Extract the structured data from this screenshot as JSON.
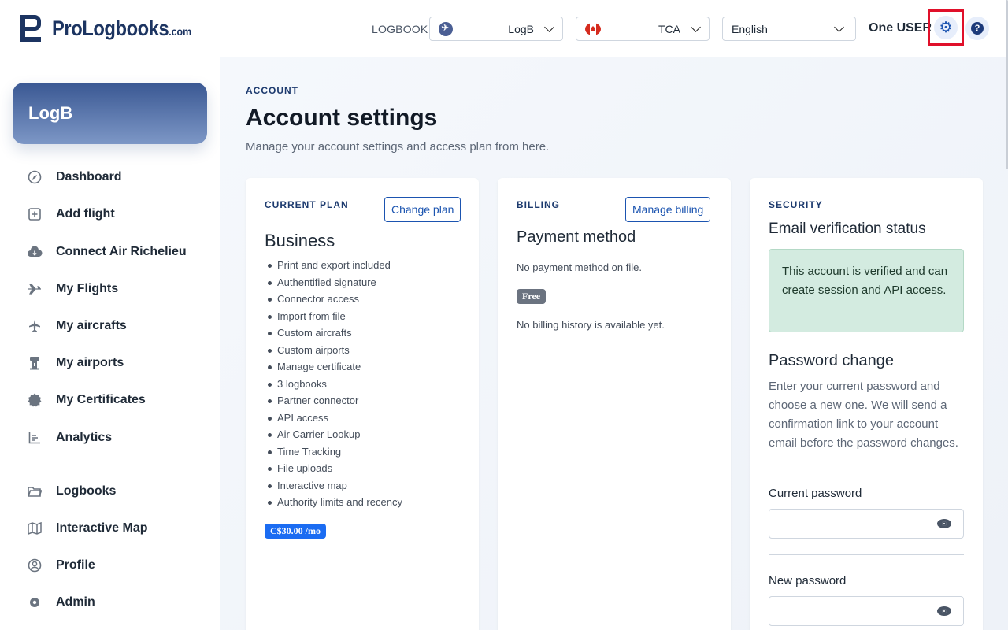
{
  "brand": {
    "name": "ProLogbooks",
    "suffix": ".com"
  },
  "header": {
    "logbook_label": "LOGBOOK",
    "logbook_select": "LogB",
    "country_select": "TCA",
    "language_select": "English",
    "user_name": "One USER",
    "help_glyph": "?"
  },
  "sidebar": {
    "logbook_card": "LogB",
    "items": [
      {
        "label": "Dashboard",
        "icon": "compass-icon"
      },
      {
        "label": "Add flight",
        "icon": "plus-square-icon"
      },
      {
        "label": "Connect Air Richelieu",
        "icon": "cloud-download-icon"
      },
      {
        "label": "My Flights",
        "icon": "plane-icon"
      },
      {
        "label": "My aircrafts",
        "icon": "aircraft-icon"
      },
      {
        "label": "My airports",
        "icon": "tower-icon"
      },
      {
        "label": "My Certificates",
        "icon": "certificate-icon"
      },
      {
        "label": "Analytics",
        "icon": "chart-icon"
      },
      {
        "label": "Logbooks",
        "icon": "folder-icon"
      },
      {
        "label": "Interactive Map",
        "icon": "map-icon"
      },
      {
        "label": "Profile",
        "icon": "user-circle-icon"
      },
      {
        "label": "Admin",
        "icon": "admin-icon"
      }
    ]
  },
  "page": {
    "eyebrow": "ACCOUNT",
    "title": "Account settings",
    "subtitle": "Manage your account settings and access plan from here."
  },
  "plan": {
    "eyebrow": "CURRENT PLAN",
    "change_button": "Change plan",
    "name": "Business",
    "features": [
      "Print and export included",
      "Authentified signature",
      "Connector access",
      "Import from file",
      "Custom aircrafts",
      "Custom airports",
      "Manage certificate",
      "3 logbooks",
      "Partner connector",
      "API access",
      "Air Carrier Lookup",
      "Time Tracking",
      "File uploads",
      "Interactive map",
      "Authority limits and recency"
    ],
    "price": "C$30.00 /mo"
  },
  "billing": {
    "eyebrow": "BILLING",
    "manage_button": "Manage billing",
    "title": "Payment method",
    "no_method": "No payment method on file.",
    "badge": "Free",
    "no_history": "No billing history is available yet."
  },
  "security": {
    "eyebrow": "SECURITY",
    "email_title": "Email verification status",
    "verified_text": "This account is verified and can create session and API access.",
    "password_title": "Password change",
    "password_desc": "Enter your current password and choose a new one. We will send a confirmation link to your account email before the password changes.",
    "current_label": "Current password",
    "current_value": "",
    "new_label": "New password",
    "new_value": ""
  },
  "colors": {
    "accent": "#1b54b0",
    "navy": "#1c3461",
    "highlight": "#e0102a",
    "verified_bg": "#d3ebe0"
  }
}
